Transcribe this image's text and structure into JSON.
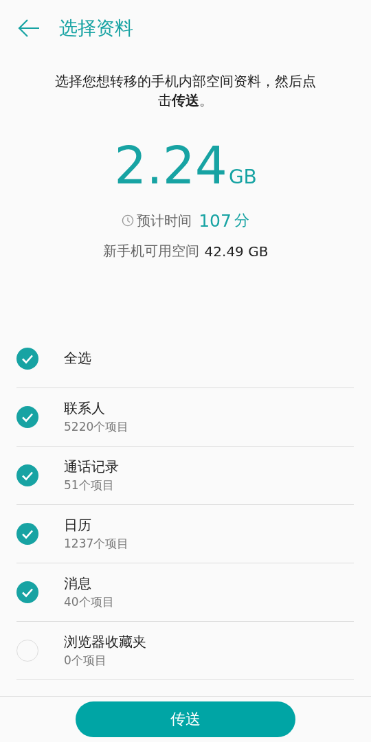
{
  "header": {
    "title": "选择资料"
  },
  "description": "选择您想转移的手机内部空间资料，然后点击**传送**。",
  "size": {
    "value": "2.24",
    "unit": "GB"
  },
  "estimate": {
    "label": "预计时间",
    "value": "107",
    "unit": "分"
  },
  "free_space": {
    "label": "新手机可用空间",
    "value": "42.49 GB"
  },
  "select_all": {
    "label": "全选",
    "checked": true
  },
  "items": [
    {
      "name": "联系人",
      "count": "5220个项目",
      "checked": true
    },
    {
      "name": "通话记录",
      "count": "51个项目",
      "checked": true
    },
    {
      "name": "日历",
      "count": "1237个项目",
      "checked": true
    },
    {
      "name": "消息",
      "count": "40个项目",
      "checked": true
    },
    {
      "name": "浏览器收藏夹",
      "count": "0个项目",
      "checked": false
    }
  ],
  "send_button": "传送"
}
